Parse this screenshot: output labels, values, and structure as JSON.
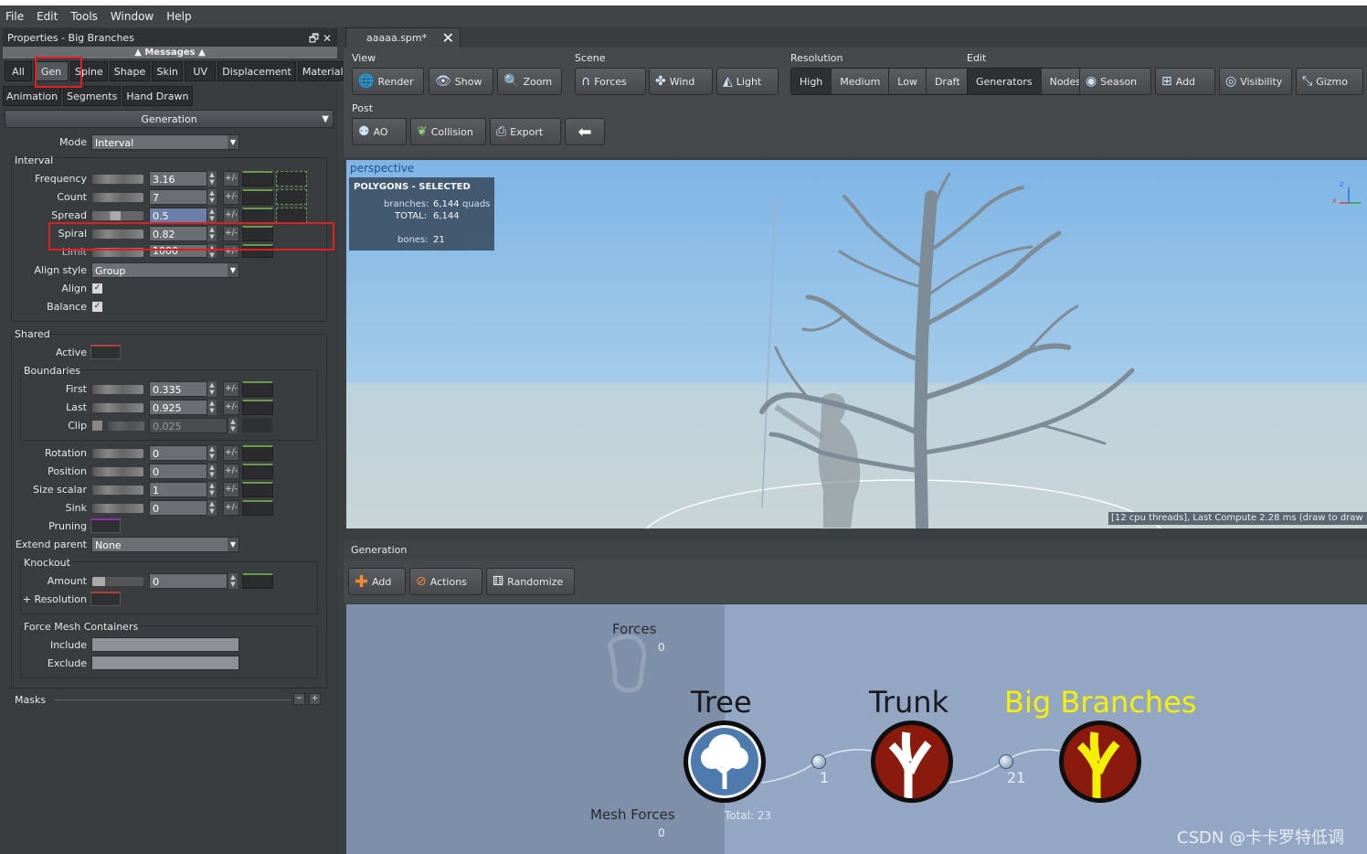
{
  "menu": [
    "File",
    "Edit",
    "Tools",
    "Window",
    "Help"
  ],
  "properties": {
    "title": "Properties - Big Branches",
    "messages": "Messages",
    "tabs_row1": [
      "All",
      "Gen",
      "Spine",
      "Shape",
      "Skin",
      "UV",
      "Displacement",
      "Material"
    ],
    "tabs_row2": [
      "Animation",
      "Segments",
      "Hand Drawn"
    ],
    "section": "Generation",
    "mode_label": "Mode",
    "mode_value": "Interval",
    "interval_label": "Interval",
    "frequency_label": "Frequency",
    "frequency_value": "3.16",
    "count_label": "Count",
    "count_value": "7",
    "spread_label": "Spread",
    "spread_value": "0.5",
    "spiral_label": "Spiral",
    "spiral_value": "0.82",
    "limit_label": "Limit",
    "limit_value": "1000",
    "align_style_label": "Align style",
    "align_style_value": "Group",
    "align_label": "Align",
    "balance_label": "Balance",
    "shared_label": "Shared",
    "active_label": "Active",
    "boundaries_label": "Boundaries",
    "first_label": "First",
    "first_value": "0.335",
    "last_label": "Last",
    "last_value": "0.925",
    "clip_label": "Clip",
    "clip_value": "0.025",
    "rotation_label": "Rotation",
    "rotation_value": "0",
    "position_label": "Position",
    "position_value": "0",
    "size_scalar_label": "Size scalar",
    "size_scalar_value": "1",
    "sink_label": "Sink",
    "sink_value": "0",
    "pruning_label": "Pruning",
    "extend_parent_label": "Extend parent",
    "extend_parent_value": "None",
    "knockout_label": "Knockout",
    "amount_label": "Amount",
    "amount_value": "0",
    "resolution_label": "+ Resolution",
    "fmc_label": "Force Mesh Containers",
    "include_label": "Include",
    "exclude_label": "Exclude",
    "masks_label": "Masks",
    "pm_text": "+/-",
    "check_mark": "✓"
  },
  "file_tab": "aaaaa.spm*",
  "toolbar": {
    "view_label": "View",
    "render": "Render",
    "show": "Show",
    "zoom": "Zoom",
    "scene_label": "Scene",
    "forces": "Forces",
    "wind": "Wind",
    "light": "Light",
    "resolution_label": "Resolution",
    "res_options": [
      "High",
      "Medium",
      "Low",
      "Draft"
    ],
    "edit_label": "Edit",
    "edit_options": [
      "Generators",
      "Nodes"
    ],
    "season": "Season",
    "add": "Add",
    "visibility": "Visibility",
    "gizmo": "Gizmo",
    "post_label": "Post",
    "ao": "AO",
    "collision": "Collision",
    "export": "Export"
  },
  "viewport": {
    "label": "perspective",
    "info_title": "POLYGONS - SELECTED",
    "branches_label": "branches:",
    "branches_value": "6,144",
    "branches_unit": "quads",
    "total_label": "TOTAL:",
    "total_value": "6,144",
    "bones_label": "bones:",
    "bones_value": "21",
    "status": "[12 cpu threads], Last Compute 2.28 ms (draw to draw"
  },
  "generation": {
    "header": "Generation",
    "add": "Add",
    "actions": "Actions",
    "randomize": "Randomize",
    "forces_label": "Forces",
    "forces_count": "0",
    "mesh_forces_label": "Mesh Forces",
    "mesh_forces_count": "0",
    "total_label": "Total: 23",
    "nodes": [
      {
        "name": "Tree"
      },
      {
        "name": "Trunk",
        "count": "1"
      },
      {
        "name": "Big Branches",
        "count": "21"
      }
    ]
  },
  "watermark": "CSDN @卡卡罗特低调",
  "colors": {
    "selected_node": "#f4f000",
    "highlight_box": "#e02020",
    "node_ring": "#8b1a0e"
  }
}
